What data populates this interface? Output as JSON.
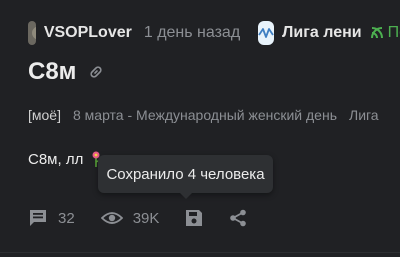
{
  "header": {
    "username": "VSOPLover",
    "avatar_icon": "user-avatar",
    "time": "1 день назад",
    "community_icon": "community-logo-icon",
    "community": "Лига лени",
    "subscribe_label": "По",
    "subscribe_color": "#4caf50"
  },
  "post": {
    "title": "С8м",
    "tags": [
      "[моё]",
      "8 марта - Международный женский день",
      "Лига"
    ],
    "content": "С8м, лл",
    "emoji": "flower-emoji"
  },
  "tooltip": {
    "text": "Сохранило 4 человека"
  },
  "footer": {
    "comments": "32",
    "views": "39K",
    "save_icon": "save-icon",
    "share_icon": "share-icon"
  }
}
